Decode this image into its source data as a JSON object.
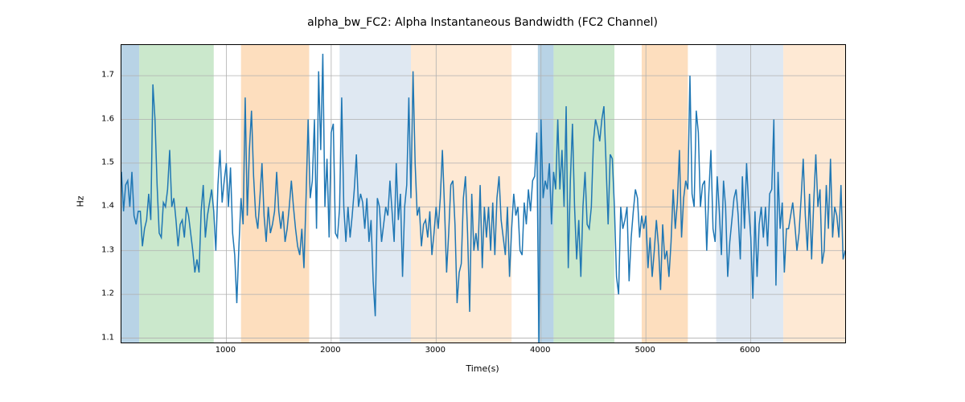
{
  "chart_data": {
    "type": "line",
    "title": "alpha_bw_FC2: Alpha Instantaneous Bandwidth (FC2 Channel)",
    "xlabel": "Time(s)",
    "ylabel": "Hz",
    "xlim": [
      0,
      6900
    ],
    "ylim": [
      1.09,
      1.77
    ],
    "xticks": [
      1000,
      2000,
      3000,
      4000,
      5000,
      6000
    ],
    "yticks": [
      1.1,
      1.2,
      1.3,
      1.4,
      1.5,
      1.6,
      1.7
    ],
    "bands": [
      {
        "x0": 0,
        "x1": 170,
        "color": "rgba(126,175,209,0.55)"
      },
      {
        "x0": 170,
        "x1": 880,
        "color": "rgba(160,214,163,0.55)"
      },
      {
        "x0": 1140,
        "x1": 1790,
        "color": "rgba(252,200,146,0.60)"
      },
      {
        "x0": 2080,
        "x1": 2760,
        "color": "rgba(197,214,232,0.55)"
      },
      {
        "x0": 2760,
        "x1": 3720,
        "color": "rgba(253,226,197,0.75)"
      },
      {
        "x0": 3970,
        "x1": 4120,
        "color": "rgba(126,175,209,0.55)"
      },
      {
        "x0": 4120,
        "x1": 4700,
        "color": "rgba(160,214,163,0.55)"
      },
      {
        "x0": 4960,
        "x1": 5400,
        "color": "rgba(252,200,146,0.60)"
      },
      {
        "x0": 5670,
        "x1": 6310,
        "color": "rgba(197,214,232,0.55)"
      },
      {
        "x0": 6310,
        "x1": 6900,
        "color": "rgba(253,226,197,0.75)"
      }
    ],
    "series": [
      {
        "name": "alpha_bw_FC2",
        "color": "#1f77b4",
        "x": [
          0,
          20,
          40,
          60,
          80,
          100,
          120,
          140,
          160,
          180,
          200,
          220,
          240,
          260,
          280,
          300,
          320,
          340,
          360,
          380,
          400,
          420,
          440,
          460,
          480,
          500,
          520,
          540,
          560,
          580,
          600,
          620,
          640,
          660,
          680,
          700,
          720,
          740,
          760,
          780,
          800,
          820,
          840,
          860,
          880,
          900,
          920,
          940,
          960,
          980,
          1000,
          1020,
          1040,
          1060,
          1080,
          1100,
          1120,
          1140,
          1160,
          1180,
          1200,
          1220,
          1240,
          1260,
          1280,
          1300,
          1320,
          1340,
          1360,
          1380,
          1400,
          1420,
          1440,
          1460,
          1480,
          1500,
          1520,
          1540,
          1560,
          1580,
          1600,
          1620,
          1640,
          1660,
          1680,
          1700,
          1720,
          1740,
          1760,
          1780,
          1800,
          1820,
          1840,
          1860,
          1880,
          1900,
          1920,
          1940,
          1960,
          1980,
          2000,
          2020,
          2040,
          2060,
          2080,
          2100,
          2120,
          2140,
          2160,
          2180,
          2200,
          2220,
          2240,
          2260,
          2280,
          2300,
          2320,
          2340,
          2360,
          2380,
          2400,
          2420,
          2440,
          2460,
          2480,
          2500,
          2520,
          2540,
          2560,
          2580,
          2600,
          2620,
          2640,
          2660,
          2680,
          2700,
          2720,
          2740,
          2760,
          2780,
          2800,
          2820,
          2840,
          2860,
          2880,
          2900,
          2920,
          2940,
          2960,
          2980,
          3000,
          3020,
          3040,
          3060,
          3080,
          3100,
          3120,
          3140,
          3160,
          3180,
          3200,
          3220,
          3240,
          3260,
          3280,
          3300,
          3320,
          3340,
          3360,
          3380,
          3400,
          3420,
          3440,
          3460,
          3480,
          3500,
          3520,
          3540,
          3560,
          3580,
          3600,
          3620,
          3640,
          3660,
          3680,
          3700,
          3720,
          3740,
          3760,
          3780,
          3800,
          3820,
          3840,
          3860,
          3880,
          3900,
          3920,
          3940,
          3960,
          3980,
          4000,
          4020,
          4040,
          4060,
          4080,
          4100,
          4120,
          4140,
          4160,
          4180,
          4200,
          4220,
          4240,
          4260,
          4280,
          4300,
          4320,
          4340,
          4360,
          4380,
          4400,
          4420,
          4440,
          4460,
          4480,
          4500,
          4520,
          4540,
          4560,
          4580,
          4600,
          4620,
          4640,
          4660,
          4680,
          4700,
          4720,
          4740,
          4760,
          4780,
          4800,
          4820,
          4840,
          4860,
          4880,
          4900,
          4920,
          4940,
          4960,
          4980,
          5000,
          5020,
          5040,
          5060,
          5080,
          5100,
          5120,
          5140,
          5160,
          5180,
          5200,
          5220,
          5240,
          5260,
          5280,
          5300,
          5320,
          5340,
          5360,
          5380,
          5400,
          5420,
          5440,
          5460,
          5480,
          5500,
          5520,
          5540,
          5560,
          5580,
          5600,
          5620,
          5640,
          5660,
          5680,
          5700,
          5720,
          5740,
          5760,
          5780,
          5800,
          5820,
          5840,
          5860,
          5880,
          5900,
          5920,
          5940,
          5960,
          5980,
          6000,
          6020,
          6040,
          6060,
          6080,
          6100,
          6120,
          6140,
          6160,
          6180,
          6200,
          6220,
          6240,
          6260,
          6280,
          6300,
          6320,
          6340,
          6360,
          6380,
          6400,
          6420,
          6440,
          6460,
          6480,
          6500,
          6520,
          6540,
          6560,
          6580,
          6600,
          6620,
          6640,
          6660,
          6680,
          6700,
          6720,
          6740,
          6760,
          6780,
          6800,
          6820,
          6840,
          6860,
          6880,
          6900
        ],
        "y": [
          1.48,
          1.39,
          1.45,
          1.46,
          1.4,
          1.48,
          1.38,
          1.36,
          1.39,
          1.39,
          1.31,
          1.35,
          1.37,
          1.43,
          1.37,
          1.68,
          1.6,
          1.45,
          1.34,
          1.33,
          1.41,
          1.4,
          1.44,
          1.53,
          1.4,
          1.42,
          1.37,
          1.31,
          1.36,
          1.37,
          1.33,
          1.4,
          1.38,
          1.34,
          1.3,
          1.25,
          1.28,
          1.25,
          1.39,
          1.45,
          1.33,
          1.38,
          1.41,
          1.44,
          1.39,
          1.3,
          1.45,
          1.53,
          1.41,
          1.46,
          1.5,
          1.4,
          1.49,
          1.34,
          1.29,
          1.18,
          1.31,
          1.42,
          1.36,
          1.65,
          1.38,
          1.53,
          1.62,
          1.47,
          1.38,
          1.35,
          1.42,
          1.5,
          1.38,
          1.32,
          1.4,
          1.34,
          1.36,
          1.39,
          1.48,
          1.39,
          1.35,
          1.39,
          1.32,
          1.35,
          1.4,
          1.46,
          1.4,
          1.35,
          1.31,
          1.29,
          1.35,
          1.26,
          1.42,
          1.6,
          1.42,
          1.46,
          1.6,
          1.35,
          1.71,
          1.53,
          1.75,
          1.4,
          1.51,
          1.33,
          1.57,
          1.59,
          1.34,
          1.33,
          1.4,
          1.65,
          1.4,
          1.32,
          1.4,
          1.33,
          1.38,
          1.44,
          1.52,
          1.4,
          1.43,
          1.41,
          1.35,
          1.42,
          1.32,
          1.37,
          1.23,
          1.15,
          1.42,
          1.4,
          1.32,
          1.36,
          1.4,
          1.38,
          1.46,
          1.39,
          1.32,
          1.5,
          1.37,
          1.43,
          1.24,
          1.4,
          1.45,
          1.65,
          1.42,
          1.71,
          1.5,
          1.38,
          1.4,
          1.31,
          1.36,
          1.37,
          1.33,
          1.39,
          1.29,
          1.34,
          1.4,
          1.35,
          1.42,
          1.53,
          1.4,
          1.25,
          1.34,
          1.45,
          1.46,
          1.36,
          1.18,
          1.25,
          1.27,
          1.42,
          1.47,
          1.34,
          1.16,
          1.43,
          1.3,
          1.34,
          1.3,
          1.45,
          1.26,
          1.4,
          1.33,
          1.4,
          1.3,
          1.41,
          1.29,
          1.42,
          1.47,
          1.37,
          1.33,
          1.29,
          1.4,
          1.24,
          1.35,
          1.43,
          1.38,
          1.4,
          1.3,
          1.29,
          1.41,
          1.36,
          1.44,
          1.39,
          1.46,
          1.47,
          1.57,
          1.09,
          1.6,
          1.42,
          1.46,
          1.44,
          1.5,
          1.36,
          1.48,
          1.44,
          1.6,
          1.44,
          1.53,
          1.4,
          1.63,
          1.26,
          1.46,
          1.59,
          1.4,
          1.28,
          1.37,
          1.24,
          1.4,
          1.48,
          1.36,
          1.35,
          1.4,
          1.55,
          1.6,
          1.58,
          1.55,
          1.6,
          1.63,
          1.5,
          1.36,
          1.52,
          1.51,
          1.4,
          1.24,
          1.2,
          1.4,
          1.35,
          1.37,
          1.4,
          1.23,
          1.33,
          1.39,
          1.44,
          1.42,
          1.33,
          1.38,
          1.35,
          1.38,
          1.26,
          1.33,
          1.24,
          1.3,
          1.37,
          1.31,
          1.21,
          1.36,
          1.28,
          1.3,
          1.24,
          1.32,
          1.44,
          1.35,
          1.41,
          1.53,
          1.33,
          1.42,
          1.46,
          1.44,
          1.7,
          1.43,
          1.4,
          1.62,
          1.57,
          1.4,
          1.45,
          1.46,
          1.3,
          1.43,
          1.53,
          1.35,
          1.32,
          1.47,
          1.39,
          1.29,
          1.46,
          1.4,
          1.24,
          1.32,
          1.37,
          1.42,
          1.44,
          1.38,
          1.28,
          1.47,
          1.35,
          1.5,
          1.4,
          1.33,
          1.19,
          1.39,
          1.24,
          1.36,
          1.4,
          1.33,
          1.4,
          1.31,
          1.43,
          1.44,
          1.6,
          1.22,
          1.48,
          1.35,
          1.41,
          1.25,
          1.35,
          1.35,
          1.38,
          1.41,
          1.36,
          1.3,
          1.34,
          1.42,
          1.51,
          1.38,
          1.3,
          1.43,
          1.28,
          1.41,
          1.52,
          1.4,
          1.44,
          1.27,
          1.3,
          1.45,
          1.35,
          1.51,
          1.33,
          1.4,
          1.38,
          1.33,
          1.45,
          1.28,
          1.3
        ]
      }
    ]
  }
}
